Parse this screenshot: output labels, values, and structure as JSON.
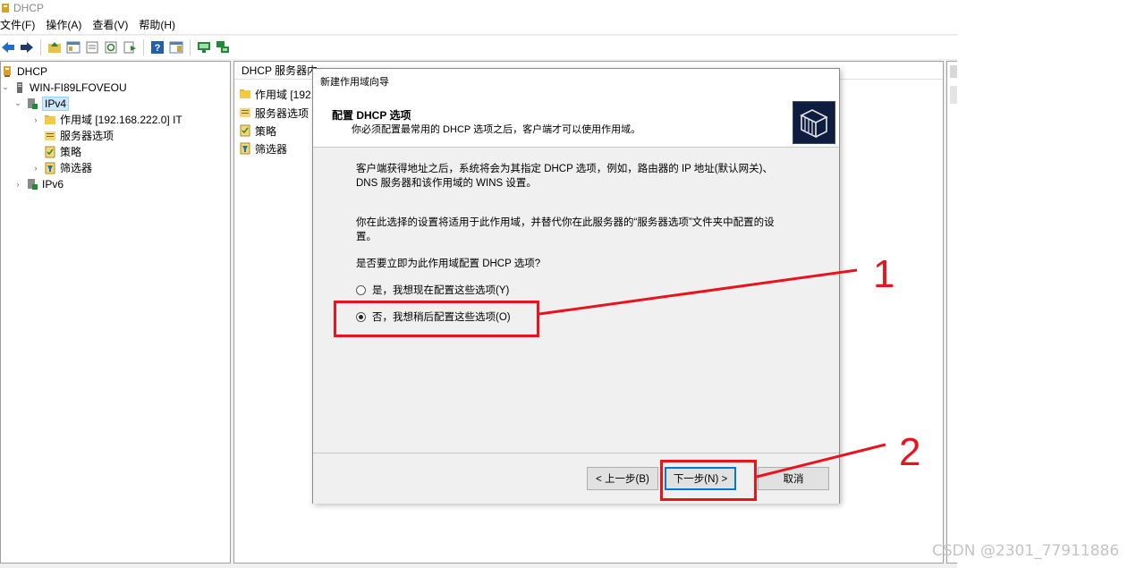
{
  "window": {
    "title": "DHCP"
  },
  "menu": [
    "文件(F)",
    "操作(A)",
    "查看(V)",
    "帮助(H)"
  ],
  "toolbar_icons": [
    "back-arrow-icon",
    "forward-arrow-icon",
    "up-folder-icon",
    "show-hide-tree-icon",
    "properties-icon",
    "refresh-icon",
    "export-list-icon",
    "help-icon",
    "action-pane-icon",
    "monitor-icon",
    "network-icon"
  ],
  "tree": {
    "root": "DHCP",
    "server": "WIN-FI89LFOVEOU",
    "ipv4": "IPv4",
    "scope": "作用域 [192.168.222.0] IT",
    "server_options": "服务器选项",
    "policies": "策略",
    "filters": "筛选器",
    "ipv6": "IPv6"
  },
  "center": {
    "header": "DHCP 服务器内",
    "rows": [
      "作用域 [192.",
      "服务器选项",
      "策略",
      "筛选器"
    ]
  },
  "wizard": {
    "title": "新建作用域向导",
    "heading": "配置 DHCP 选项",
    "subheading": "你必须配置最常用的 DHCP 选项之后，客户端才可以使用作用域。",
    "para1_line1": "客户端获得地址之后，系统将会为其指定 DHCP 选项，例如，路由器的 IP 地址(默认网关)、",
    "para1_line2": "DNS 服务器和该作用域的 WINS 设置。",
    "para2_line1": "你在此选择的设置将适用于此作用域，并替代你在此服务器的“服务器选项”文件夹中配置的设",
    "para2_line2": "置。",
    "question": "是否要立即为此作用域配置 DHCP 选项?",
    "option_yes": "是，我想现在配置这些选项(Y)",
    "option_no": "否，我想稍后配置这些选项(O)",
    "selected_option": "no",
    "back_button": "< 上一步(B)",
    "next_button": "下一步(N) >",
    "cancel_button": "取消"
  },
  "annotations": {
    "marker1": "1",
    "marker2": "2",
    "color": "#e8141d"
  },
  "watermark": "CSDN @2301_77911886"
}
